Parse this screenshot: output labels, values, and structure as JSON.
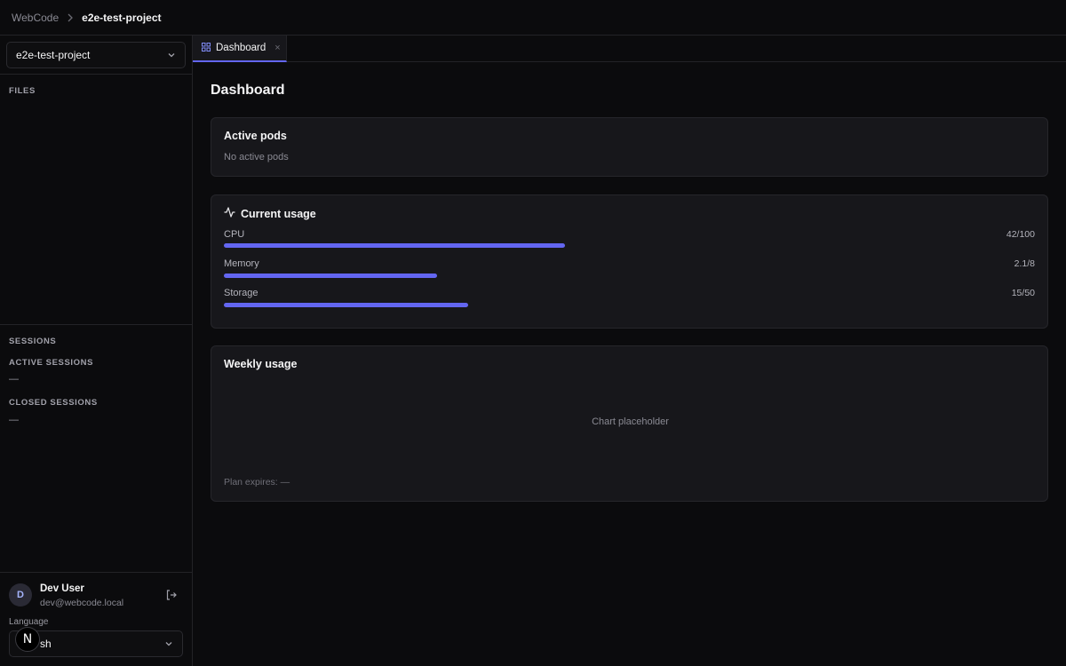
{
  "breadcrumb": {
    "root": "WebCode",
    "current": "e2e-test-project"
  },
  "sidebar": {
    "project": "e2e-test-project",
    "files_label": "FILES",
    "sessions_label": "SESSIONS",
    "active_sessions_label": "ACTIVE SESSIONS",
    "active_sessions_value": "—",
    "closed_sessions_label": "CLOSED SESSIONS",
    "closed_sessions_value": "—",
    "user": {
      "initial": "D",
      "name": "Dev User",
      "email": "dev@webcode.local"
    },
    "language_label": "Language",
    "language_value": "sh",
    "badge": "N"
  },
  "tabs": [
    {
      "label": "Dashboard",
      "close": "×"
    }
  ],
  "dashboard": {
    "title": "Dashboard",
    "active_pods": {
      "title": "Active pods",
      "empty": "No active pods"
    },
    "usage": {
      "title": "Current usage",
      "meters": [
        {
          "label": "CPU",
          "value": "42/100",
          "fraction": 0.42
        },
        {
          "label": "Memory",
          "value": "2.1/8",
          "fraction": 0.2625
        },
        {
          "label": "Storage",
          "value": "15/50",
          "fraction": 0.3
        }
      ]
    },
    "weekly": {
      "title": "Weekly usage",
      "placeholder": "Chart placeholder",
      "plan": "Plan expires: —"
    }
  },
  "colors": {
    "accent": "#6366f1",
    "background": "#0b0b0d",
    "card": "#17171b"
  },
  "icons": [
    "chevron-right-icon",
    "chevron-down-icon",
    "grid-icon",
    "close-icon",
    "activity-icon",
    "logout-icon"
  ]
}
